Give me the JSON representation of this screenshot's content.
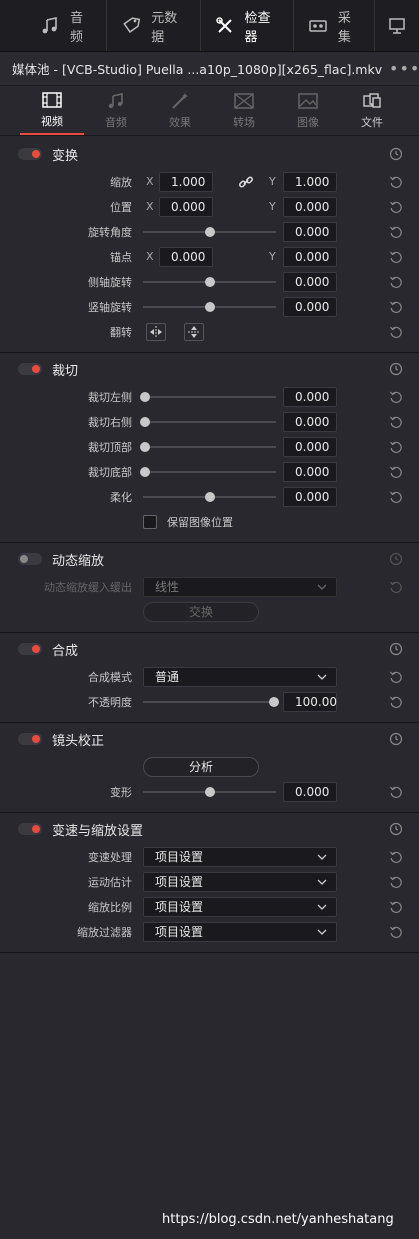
{
  "topbar": {
    "tabs": [
      {
        "label": "音频",
        "icon": "music-note-icon"
      },
      {
        "label": "元数据",
        "icon": "tag-icon"
      },
      {
        "label": "检查器",
        "icon": "tools-icon"
      },
      {
        "label": "采集",
        "icon": "tape-icon"
      },
      {
        "label": "",
        "icon": "monitor-icon"
      }
    ]
  },
  "titlebar": {
    "title": "媒体池 - [VCB-Studio] Puella ...a10p_1080p][x265_flac].mkv",
    "more": "•••"
  },
  "subtabs": [
    "视频",
    "音频",
    "效果",
    "转场",
    "图像",
    "文件"
  ],
  "transform": {
    "title": "变换",
    "zoom_label": "缩放",
    "zoom_x": "1.000",
    "zoom_y": "1.000",
    "position_label": "位置",
    "position_x": "0.000",
    "position_y": "0.000",
    "rotation_label": "旋转角度",
    "rotation": "0.000",
    "anchor_label": "锚点",
    "anchor_x": "0.000",
    "anchor_y": "0.000",
    "pitch_label": "侧轴旋转",
    "pitch": "0.000",
    "yaw_label": "竖轴旋转",
    "yaw": "0.000",
    "flip_label": "翻转",
    "x_axis": "X",
    "y_axis": "Y"
  },
  "crop": {
    "title": "裁切",
    "left_label": "裁切左侧",
    "left": "0.000",
    "right_label": "裁切右侧",
    "right": "0.000",
    "top_label": "裁切顶部",
    "top": "0.000",
    "bottom_label": "裁切底部",
    "bottom": "0.000",
    "soft_label": "柔化",
    "soft": "0.000",
    "retain_label": "保留图像位置"
  },
  "dynamic_zoom": {
    "title": "动态缩放",
    "ease_label": "动态缩放缓入缓出",
    "ease_value": "线性",
    "swap_label": "交换"
  },
  "composite": {
    "title": "合成",
    "mode_label": "合成模式",
    "mode_value": "普通",
    "opacity_label": "不透明度",
    "opacity": "100.00"
  },
  "lens": {
    "title": "镜头校正",
    "analyze_label": "分析",
    "distortion_label": "变形",
    "distortion": "0.000"
  },
  "retime": {
    "title": "变速与缩放设置",
    "process_label": "变速处理",
    "process_value": "项目设置",
    "motion_label": "运动估计",
    "motion_value": "项目设置",
    "scale_label": "缩放比例",
    "scale_value": "项目设置",
    "filter_label": "缩放过滤器",
    "filter_value": "项目设置"
  },
  "watermark": "https://blog.csdn.net/yanheshatang",
  "colors": {
    "accent": "#e84b3c",
    "background": "#28282e"
  }
}
